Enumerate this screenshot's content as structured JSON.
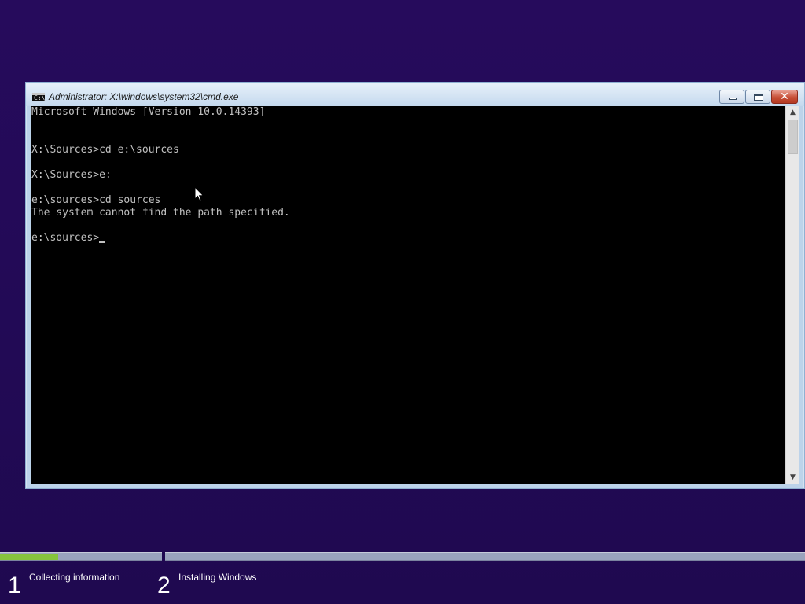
{
  "window": {
    "title": "Administrator: X:\\windows\\system32\\cmd.exe",
    "icon": "command-prompt-icon",
    "icon_text": "C:\\"
  },
  "console": {
    "lines": [
      "Microsoft Windows [Version 10.0.14393]",
      "",
      "",
      "X:\\Sources>cd e:\\sources",
      "",
      "X:\\Sources>e:",
      "",
      "e:\\sources>cd sources",
      "The system cannot find the path specified.",
      ""
    ],
    "prompt": "e:\\sources>"
  },
  "setup": {
    "progress": 0.36,
    "steps": [
      {
        "number": "1",
        "label": "Collecting information"
      },
      {
        "number": "2",
        "label": "Installing Windows"
      }
    ]
  },
  "colors": {
    "background": "#240a5a",
    "console_text": "#c0c0c0",
    "progress_fill": "#86c43d"
  }
}
